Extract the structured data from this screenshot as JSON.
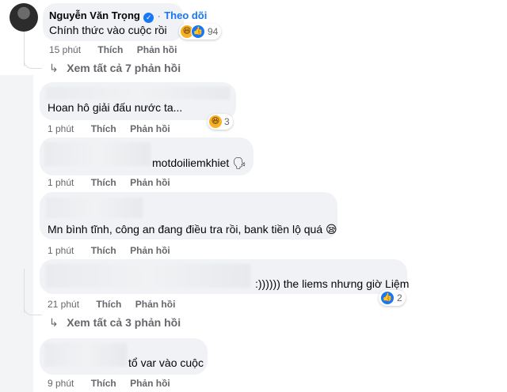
{
  "top_comment": {
    "author": "Nguyễn Văn Trọng",
    "follow_label": "Theo dõi",
    "text": "Chính thức vào cuộc rồi",
    "reaction_count": "94",
    "time": "15 phút",
    "like_label": "Thích",
    "reply_label": "Phản hồi",
    "view_replies": "Xem tất cả 7 phản hồi"
  },
  "comments": [
    {
      "text": "Hoan hô giải đấu nước ta...",
      "time": "1 phút",
      "like_label": "Thích",
      "reply_label": "Phản hồi",
      "reaction_count": "3"
    },
    {
      "text": "motdoiliemkhiet 🗣",
      "time": "1 phút",
      "like_label": "Thích",
      "reply_label": "Phản hồi"
    },
    {
      "text": "Mn bình tĩnh, công an đang điều tra rồi, bank tiền lộ quá 😪",
      "time": "1 phút",
      "like_label": "Thích",
      "reply_label": "Phản hồi"
    },
    {
      "text": ":)))))) the liems nhưng giờ Liệm",
      "time": "21 phút",
      "like_label": "Thích",
      "reply_label": "Phản hồi",
      "reaction_count": "2",
      "view_replies": "Xem tất cả 3 phản hồi"
    },
    {
      "text": "tổ var vào cuộc",
      "time": "9 phút",
      "like_label": "Thích",
      "reply_label": "Phản hồi"
    }
  ],
  "icons": {
    "verified": "verified-badge-icon",
    "haha": "haha-reaction-icon",
    "like": "like-reaction-icon",
    "reply_arrow": "reply-arrow-icon"
  },
  "colors": {
    "link": "#1877f2",
    "bubble": "#f0f2f5",
    "meta": "#65676b"
  }
}
